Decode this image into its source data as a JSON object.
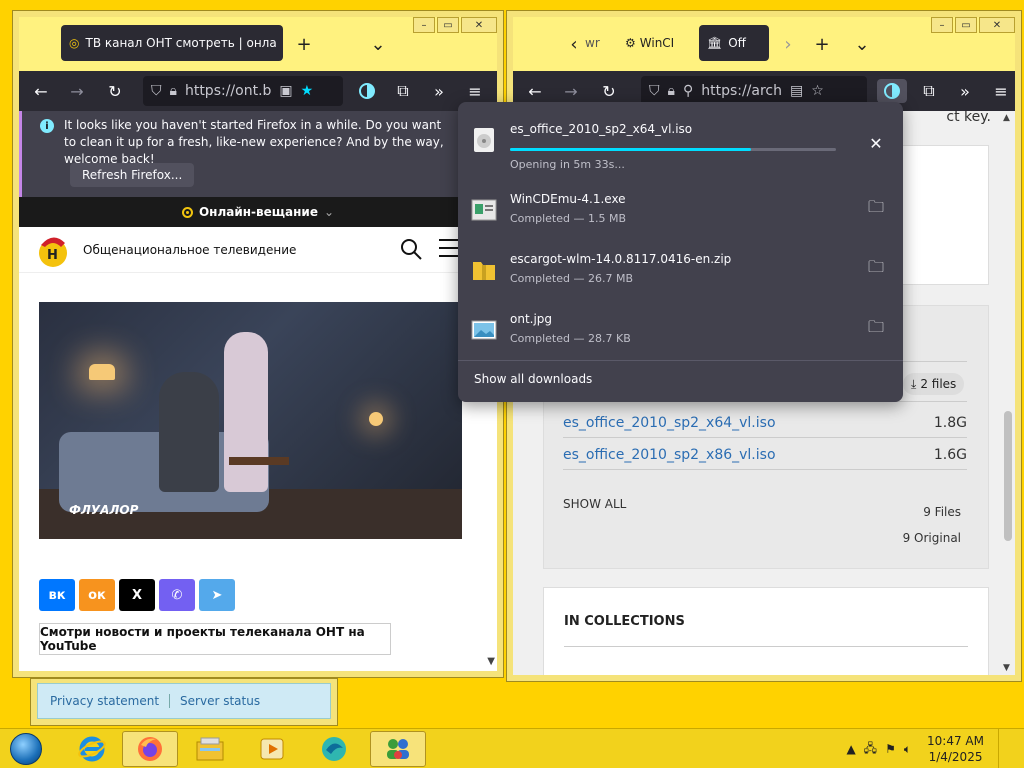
{
  "left_window": {
    "tab_title": "ТВ канал ОНТ смотреть | онла",
    "url": "https://ont.b",
    "notification": {
      "text": "It looks like you haven't started Firefox in a while. Do you want to clean it up for a fresh, like-new experience? And by the way, welcome back!",
      "button": "Refresh Firefox..."
    },
    "onair_label": "Онлайн-вещание",
    "site_name": "Общенациональное телевидение",
    "video_watermark": "ФЛУАЛОР",
    "share_buttons": [
      "вк",
      "ок",
      "X",
      "viber",
      "telegram"
    ],
    "youtube_button": "Смотри новости и проекты телеканала ОНТ на YouTube"
  },
  "right_window": {
    "tabs": [
      {
        "label": "wr"
      },
      {
        "label": "WinCI"
      },
      {
        "label": "Off"
      }
    ],
    "url": "https://arch",
    "top_text": "ct key.",
    "files_badge": "2 files",
    "files": [
      {
        "name": "es_office_2010_sp2_x64_vl.iso",
        "size": "1.8G"
      },
      {
        "name": "es_office_2010_sp2_x86_vl.iso",
        "size": "1.6G"
      }
    ],
    "show_all": "SHOW ALL",
    "files_count": "9 Files",
    "original_count": "9 Original",
    "collections_title": "IN COLLECTIONS"
  },
  "downloads": {
    "items": [
      {
        "name": "es_office_2010_sp2_x64_vl.iso",
        "status": "Opening in 5m 33s...",
        "progress": 0.74,
        "action": "cancel"
      },
      {
        "name": "WinCDEmu-4.1.exe",
        "status": "Completed — 1.5 MB",
        "action": "folder"
      },
      {
        "name": "escargot-wlm-14.0.8117.0416-en.zip",
        "status": "Completed — 26.7 MB",
        "action": "folder"
      },
      {
        "name": "ont.jpg",
        "status": "Completed — 28.7 KB",
        "action": "folder"
      }
    ],
    "show_all": "Show all downloads"
  },
  "behind_window": {
    "privacy": "Privacy statement",
    "server": "Server status"
  },
  "taskbar": {
    "time": "10:47 AM",
    "date": "1/4/2025"
  },
  "colors": {
    "desktop": "#ffd200",
    "firefox_dark": "#2b2a33",
    "progress_accent": "#00ddff",
    "link_blue": "#2b6db3"
  }
}
